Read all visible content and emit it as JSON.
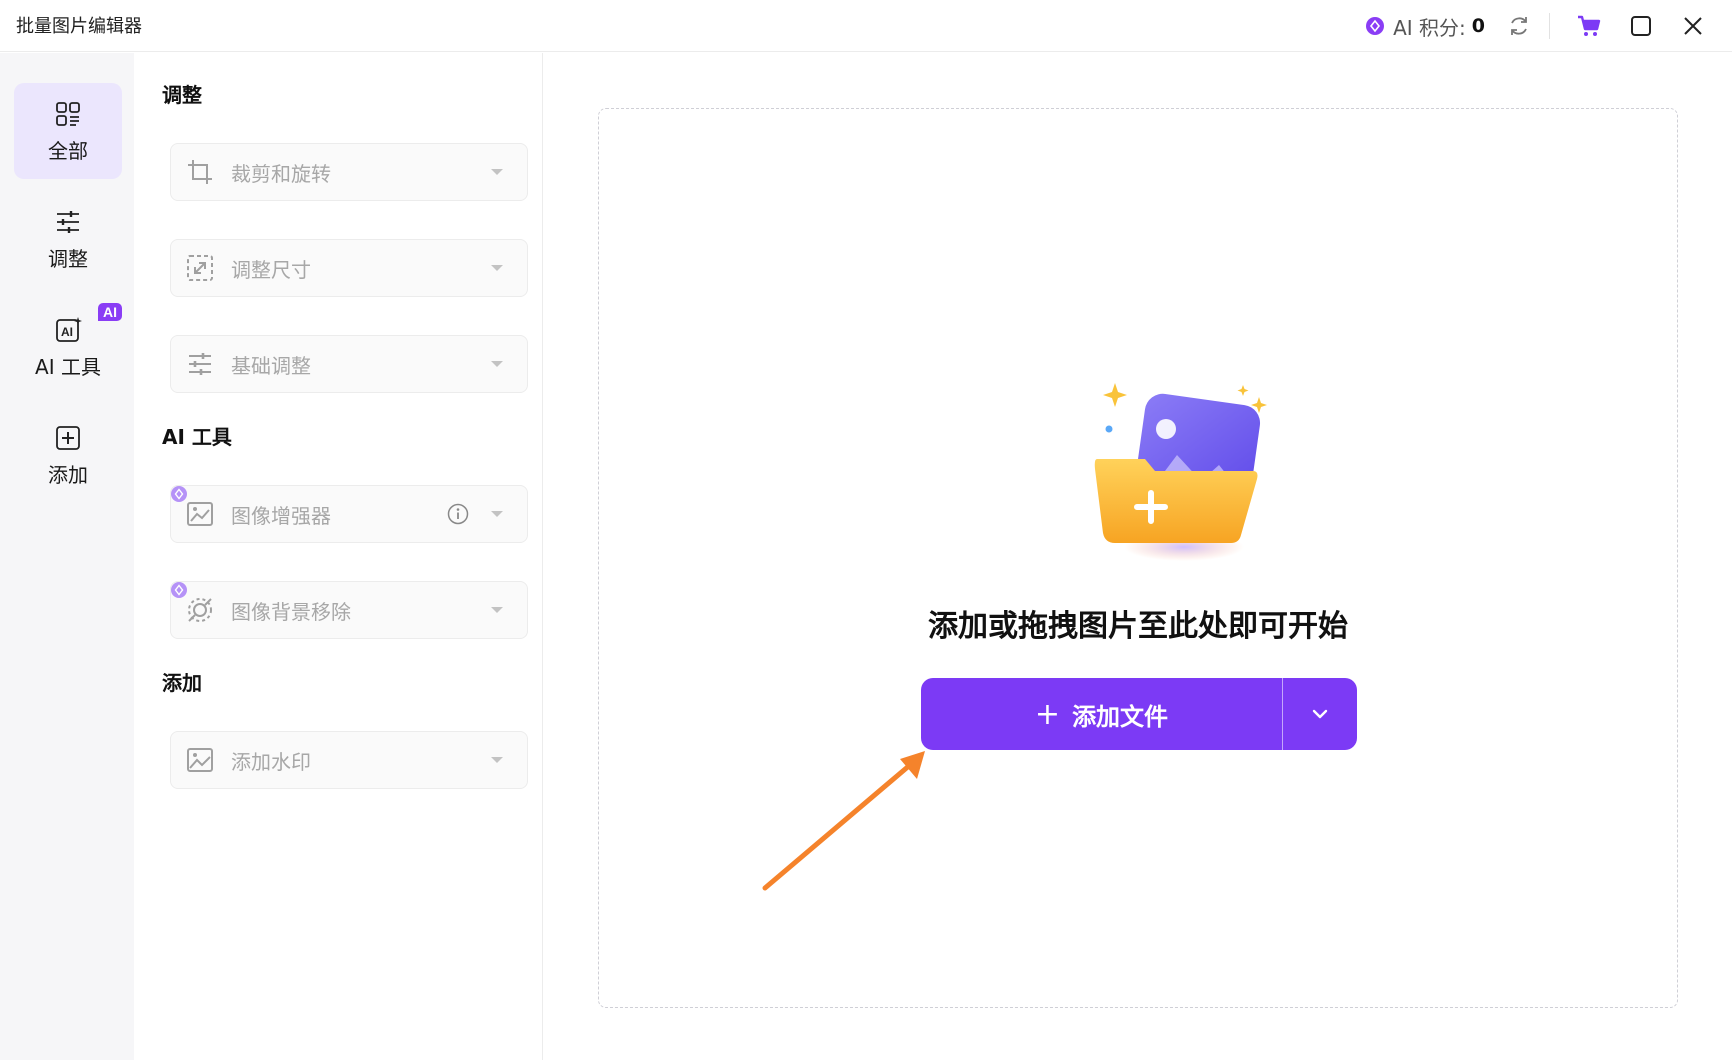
{
  "app": {
    "title": "批量图片编辑器"
  },
  "titlebar": {
    "ai_points_label": "AI 积分:",
    "ai_points_value": "0"
  },
  "nav": {
    "items": [
      {
        "label": "全部",
        "icon": "grid-icon",
        "active": true
      },
      {
        "label": "调整",
        "icon": "sliders-icon"
      },
      {
        "label": "AI 工具",
        "icon": "ai-image-icon",
        "badge": "AI"
      },
      {
        "label": "添加",
        "icon": "plus-square-icon"
      }
    ]
  },
  "panel": {
    "sections": [
      {
        "title": "调整",
        "tools": [
          "裁剪和旋转",
          "调整尺寸",
          "基础调整"
        ]
      },
      {
        "title": "AI 工具",
        "tools": [
          "图像增强器",
          "图像背景移除"
        ]
      },
      {
        "title": "添加",
        "tools": [
          "添加水印"
        ]
      }
    ]
  },
  "main": {
    "drop_text": "添加或拖拽图片至此处即可开始",
    "add_button_label": "添加文件",
    "add_button_plus": "+"
  },
  "colors": {
    "accent": "#7c3af5",
    "active_nav_bg": "#ebe6fd",
    "arrow": "#f5832b"
  }
}
